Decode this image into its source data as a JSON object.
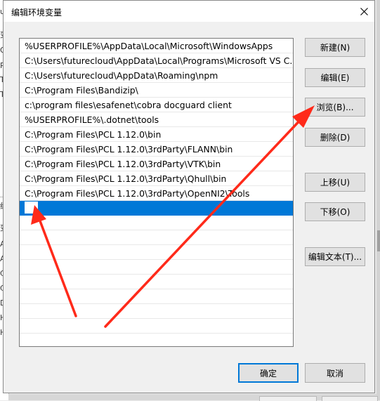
{
  "dialog": {
    "title": "编辑环境变量",
    "close_symbol": "×"
  },
  "path_list": {
    "items": [
      "%USERPROFILE%\\AppData\\Local\\Microsoft\\WindowsApps",
      "C:\\Users\\futurecloud\\AppData\\Local\\Programs\\Microsoft VS C...",
      "C:\\Users\\futurecloud\\AppData\\Roaming\\npm",
      "C:\\Program Files\\Bandizip\\",
      "c:\\program files\\esafenet\\cobra docguard client",
      "%USERPROFILE%\\.dotnet\\tools",
      "C:\\Program Files\\PCL 1.12.0\\bin",
      "C:\\Program Files\\PCL 1.12.0\\3rdParty\\FLANN\\bin",
      "C:\\Program Files\\PCL 1.12.0\\3rdParty\\VTK\\bin",
      "C:\\Program Files\\PCL 1.12.0\\3rdParty\\Qhull\\bin",
      "C:\\Program Files\\PCL 1.12.0\\3rdParty\\OpenNI2\\Tools"
    ],
    "new_item_value": ""
  },
  "buttons": {
    "new": "新建(N)",
    "edit": "编辑(E)",
    "browse": "浏览(B)...",
    "delete": "删除(D)",
    "move_up": "上移(U)",
    "move_down": "下移(O)",
    "edit_text": "编辑文本(T)...",
    "ok": "确定",
    "cancel": "取消"
  },
  "background": {
    "left_edge_chars": [
      "u",
      "变",
      "O",
      "Pa",
      "TE",
      "TN",
      "统",
      "变",
      "AL",
      "Au",
      "CL",
      "Co",
      "Dr",
      "HA",
      "HA"
    ]
  },
  "colors": {
    "selection": "#0078d7",
    "arrow": "#ff2a1a",
    "dialog_bg": "#f0f0f0"
  }
}
